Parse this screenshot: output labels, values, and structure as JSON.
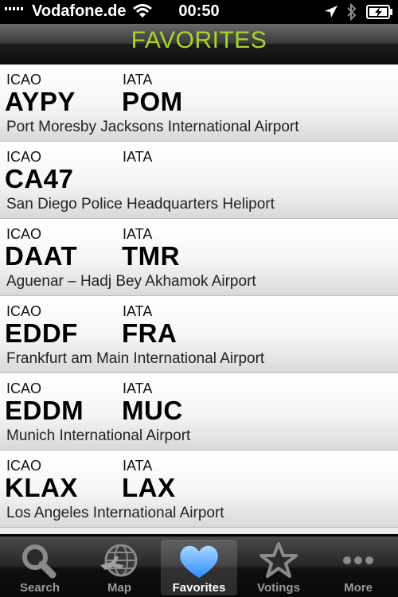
{
  "status_bar": {
    "carrier": "Vodafone.de",
    "time": "00:50"
  },
  "header": {
    "title": "FAVORITES"
  },
  "labels": {
    "icao": "ICAO",
    "iata": "IATA"
  },
  "favorites": [
    {
      "icao": "AYPY",
      "iata": "POM",
      "name": "Port Moresby Jacksons International Airport"
    },
    {
      "icao": "CA47",
      "iata": "",
      "name": "San Diego Police Headquarters Heliport"
    },
    {
      "icao": "DAAT",
      "iata": "TMR",
      "name": "Aguenar – Hadj Bey Akhamok Airport"
    },
    {
      "icao": "EDDF",
      "iata": "FRA",
      "name": "Frankfurt am Main International Airport"
    },
    {
      "icao": "EDDM",
      "iata": "MUC",
      "name": "Munich International Airport"
    },
    {
      "icao": "KLAX",
      "iata": "LAX",
      "name": "Los Angeles International Airport"
    }
  ],
  "tabs": [
    {
      "label": "Search",
      "icon": "search-icon",
      "active": false
    },
    {
      "label": "Map",
      "icon": "globe-icon",
      "active": false
    },
    {
      "label": "Favorites",
      "icon": "heart-icon",
      "active": true
    },
    {
      "label": "Votings",
      "icon": "star-icon",
      "active": false
    },
    {
      "label": "More",
      "icon": "more-icon",
      "active": false
    }
  ],
  "colors": {
    "header_title": "#a6d62a",
    "favorites_heart": "#4aa3ff"
  }
}
